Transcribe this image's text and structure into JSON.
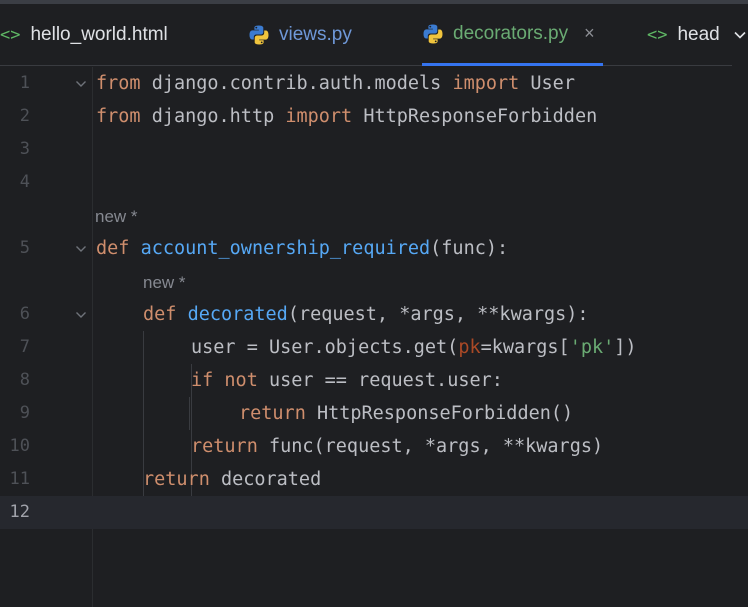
{
  "tabs": [
    {
      "name": "tab-hello-world",
      "label": "hello_world.html",
      "icon": "html-tag-icon",
      "icon_text": "<>"
    },
    {
      "name": "tab-views",
      "label": "views.py",
      "icon": "python-icon"
    },
    {
      "name": "tab-decorators",
      "label": "decorators.py",
      "icon": "python-icon",
      "active": true,
      "close": "×"
    },
    {
      "name": "tab-head",
      "label": "head",
      "icon": "html-tag-icon",
      "icon_text": "<>"
    }
  ],
  "editor": {
    "current_line": 12,
    "inlay_hint_1": "new *",
    "inlay_hint_2": "new *",
    "lines": [
      {
        "n": "1"
      },
      {
        "n": "2"
      },
      {
        "n": "3"
      },
      {
        "n": "4"
      },
      {
        "n": "5"
      },
      {
        "n": "6"
      },
      {
        "n": "7"
      },
      {
        "n": "8"
      },
      {
        "n": "9"
      },
      {
        "n": "10"
      },
      {
        "n": "11"
      },
      {
        "n": "12"
      }
    ],
    "tokens": {
      "l1": [
        "from",
        " django.contrib.auth.models ",
        "import",
        " User"
      ],
      "l2": [
        "from",
        " django.http ",
        "import",
        " HttpResponseForbidden"
      ],
      "l5": [
        "def",
        " ",
        "account_ownership_required",
        "(func):"
      ],
      "l6": [
        "def",
        " ",
        "decorated",
        "(request, *args, **kwargs):"
      ],
      "l7": [
        "user = User.objects.get(",
        "pk",
        "=kwargs[",
        "'pk'",
        "])"
      ],
      "l8": [
        "if",
        " ",
        "not",
        " user == request.user:"
      ],
      "l9": [
        "return",
        " HttpResponseForbidden()"
      ],
      "l10": [
        "return",
        " func(request, *args, **kwargs)"
      ],
      "l11": [
        "return",
        " decorated"
      ]
    }
  },
  "colors": {
    "background": "#1e1f22",
    "keyword": "#cf8e6d",
    "function": "#56a8f5",
    "string": "#6aab73",
    "parameter": "#aa4926",
    "active_tab_accent": "#3574f0"
  }
}
